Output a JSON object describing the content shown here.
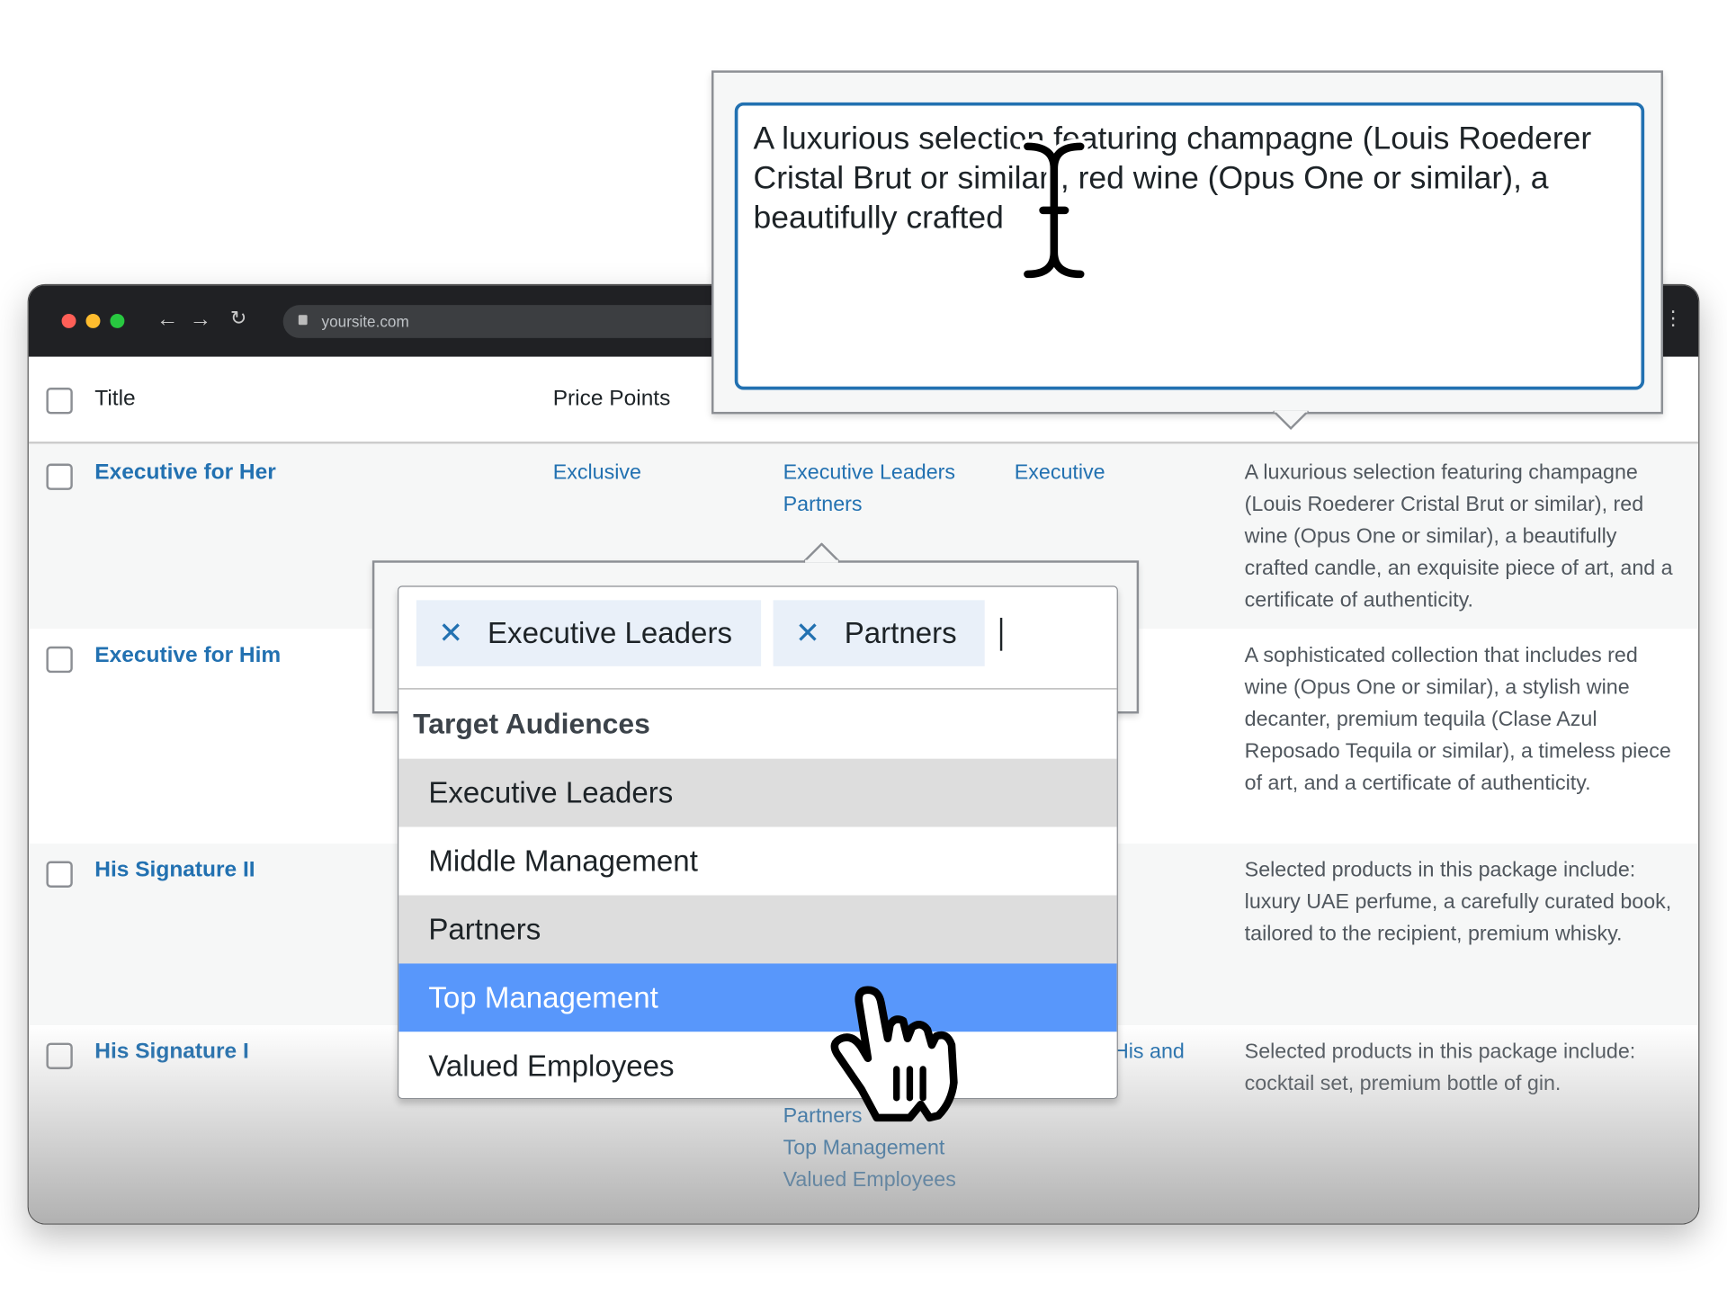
{
  "browser": {
    "url": "yoursite.com",
    "traffic_lights": [
      "#ff5f57",
      "#febc2e",
      "#28c840"
    ]
  },
  "table": {
    "headers": {
      "title": "Title",
      "price": "Price Points"
    },
    "rows": [
      {
        "title": "Executive for Her",
        "price": "Exclusive",
        "audiences": [
          "Executive Leaders",
          "Partners"
        ],
        "col4": "Executive",
        "desc": "A luxurious selection featuring champagne (Louis Roederer Cristal Brut or similar), red wine (Opus One or similar), a beautifully crafted candle, an exquisite piece of art, and a certificate of authenticity."
      },
      {
        "title": "Executive for Him",
        "desc": "A sophisticated collection that includes red wine (Opus One or similar), a stylish wine decanter, premium tequila (Clase Azul Reposado Tequila or similar), a timeless piece of art, and a certificate of authenticity."
      },
      {
        "title": "His Signature II",
        "desc": "Selected products in this package include: luxury UAE perfume, a carefully curated book, tailored to the recipient, premium whisky."
      },
      {
        "title": "His Signature I",
        "audiences": [
          "Partners",
          "Top Management",
          "Valued Employees"
        ],
        "col4": "His and",
        "desc": "Selected products in this package include: cocktail set, premium bottle of gin."
      }
    ]
  },
  "editor": {
    "text": "A luxurious selection featuring champagne (Louis Roederer Cristal Brut or similar), red wine (Opus One or similar), a beautifully crafted"
  },
  "select": {
    "tags": [
      "Executive Leaders",
      "Partners"
    ],
    "remove_glyph": "✕",
    "group": "Target Audiences",
    "options": [
      {
        "label": "Executive Leaders",
        "state": "selected"
      },
      {
        "label": "Middle Management",
        "state": "normal"
      },
      {
        "label": "Partners",
        "state": "selected"
      },
      {
        "label": "Top Management",
        "state": "highlighted"
      },
      {
        "label": "Valued Employees",
        "state": "normal"
      }
    ],
    "colors": {
      "highlight": "#5897fb",
      "selected": "#dddddd",
      "accent": "#2271b1"
    }
  }
}
